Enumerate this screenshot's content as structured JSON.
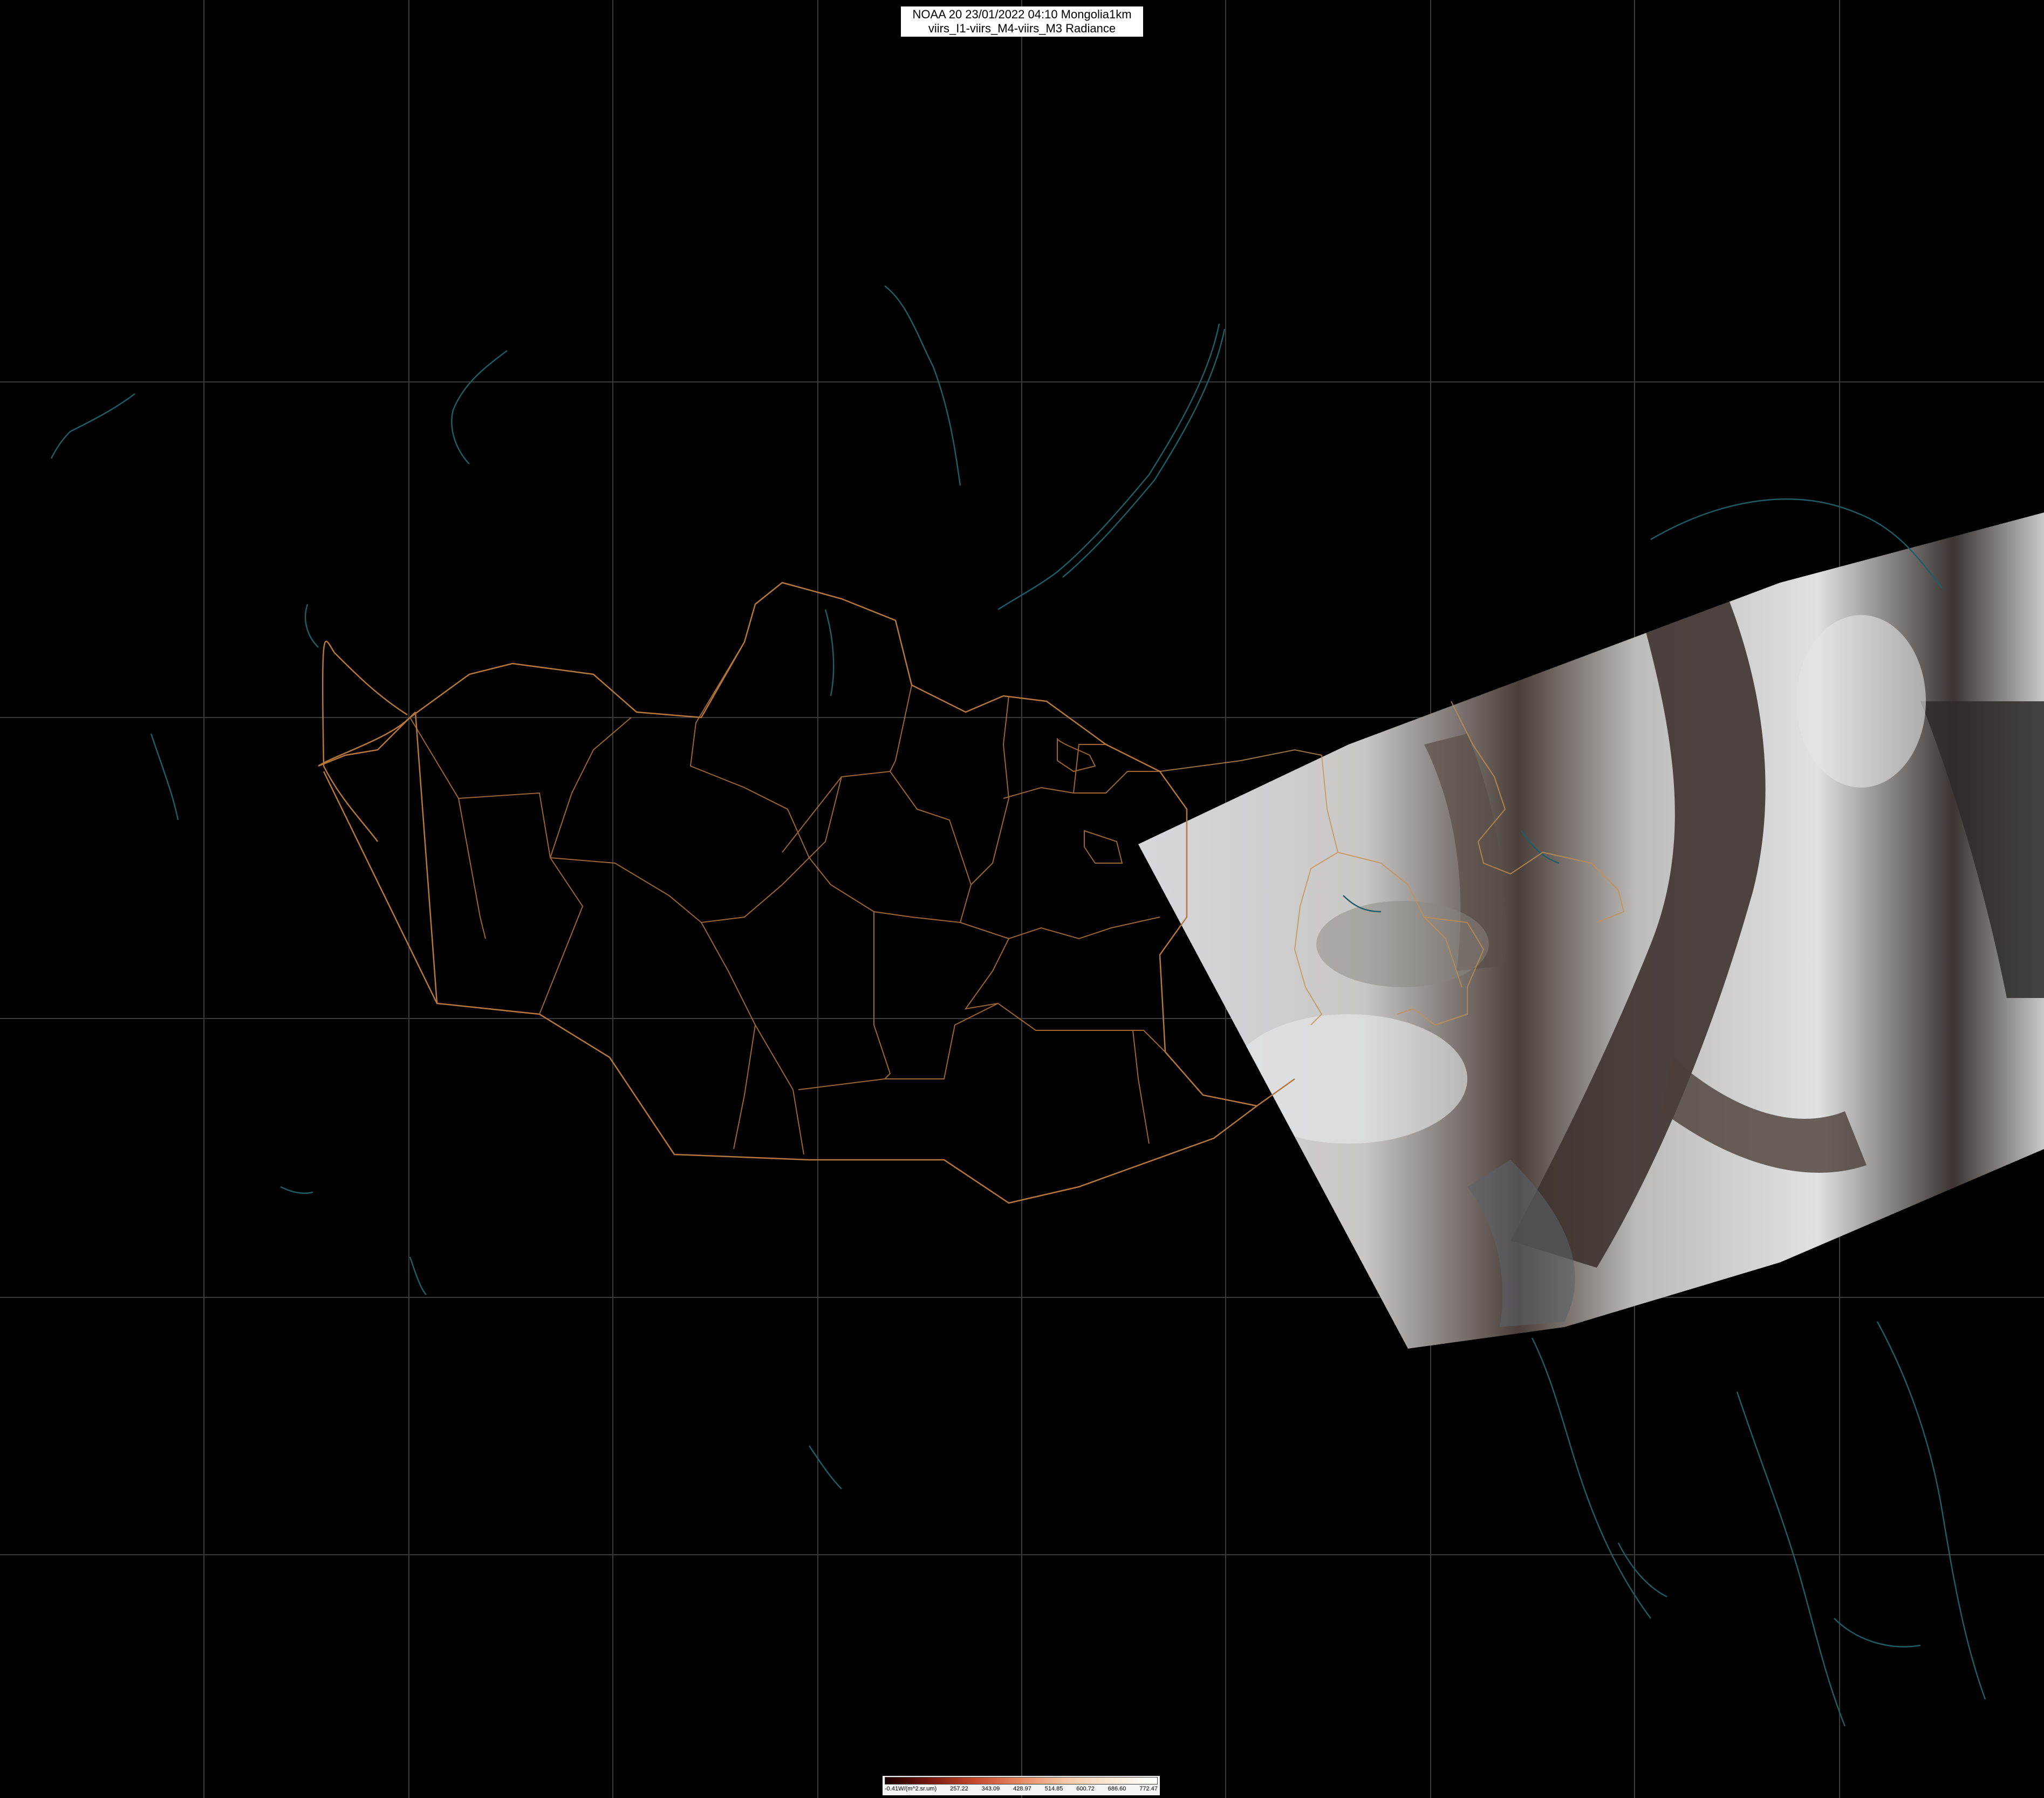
{
  "title": {
    "line1": "NOAA 20 23/01/2022 04:10 Mongolia1km",
    "line2": "viirs_I1-viirs_M4-viirs_M3 Radiance"
  },
  "colorbar": {
    "labels": [
      "-0.41W/(m^2.sr.um)",
      "257.22",
      "343.09",
      "428.97",
      "514.85",
      "600.72",
      "686.60",
      "772.47"
    ],
    "colors": [
      "#1a0000",
      "#7a1a10",
      "#c84a2e",
      "#e88a66",
      "#f5c9a8",
      "#fbe9d6",
      "#ffffff"
    ]
  },
  "colors": {
    "background": "#000000",
    "grid": "#3a3a3a",
    "borders": "#b8773a",
    "water": "#1f5d66",
    "swath_snow": "#d8d9db",
    "swath_bare": "#3a3230"
  }
}
